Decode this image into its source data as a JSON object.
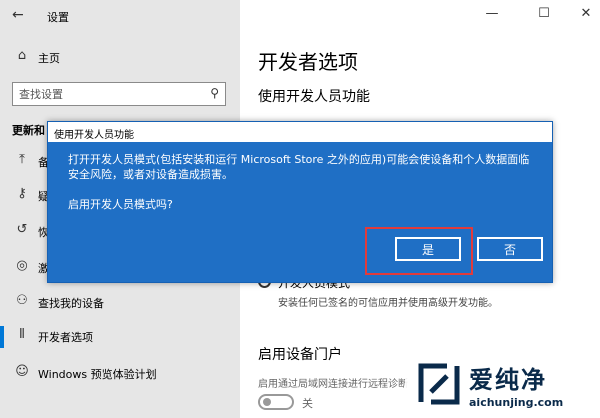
{
  "window": {
    "title": "设置",
    "back_icon": "arrow-left-icon",
    "controls": [
      "—",
      "☐",
      "✕"
    ]
  },
  "sidebar": {
    "home_label": "主页",
    "search_placeholder": "查找设置",
    "section_label": "更新和",
    "items": [
      {
        "label": "备",
        "icon": "arrow-up-icon"
      },
      {
        "label": "疑",
        "icon": "key-icon"
      },
      {
        "label": "恢",
        "icon": "history-icon"
      },
      {
        "label": "激",
        "icon": "check-circle-icon"
      },
      {
        "label": "查找我的设备",
        "icon": "person-pin-icon"
      },
      {
        "label": "开发者选项",
        "icon": "developer-icon",
        "active": true
      },
      {
        "label": "Windows 预览体验计划",
        "icon": "cat-icon"
      }
    ]
  },
  "main": {
    "page_title": "开发者选项",
    "subtitle": "使用开发人员功能",
    "radio_label": "开发人员模式",
    "radio_desc": "安装任何已签名的可信应用并使用高级开发功能。",
    "section2_title": "启用设备门户",
    "section2_desc": "启用通过局域网连接进行远程诊断",
    "toggle_label": "关"
  },
  "dialog": {
    "title": "使用开发人员功能",
    "message": "打开开发人员模式(包括安装和运行 Microsoft Store 之外的应用)可能会使设备和个人数据面临安全风险，或者对设备造成损害。",
    "question": "启用开发人员模式吗?",
    "yes_label": "是",
    "no_label": "否"
  },
  "watermark": {
    "brand": "爱纯净",
    "url": "aichunjing.com"
  },
  "colors": {
    "dialog_bg": "#1f6fc5",
    "accent": "#0078d7",
    "highlight": "#e23b3b"
  }
}
